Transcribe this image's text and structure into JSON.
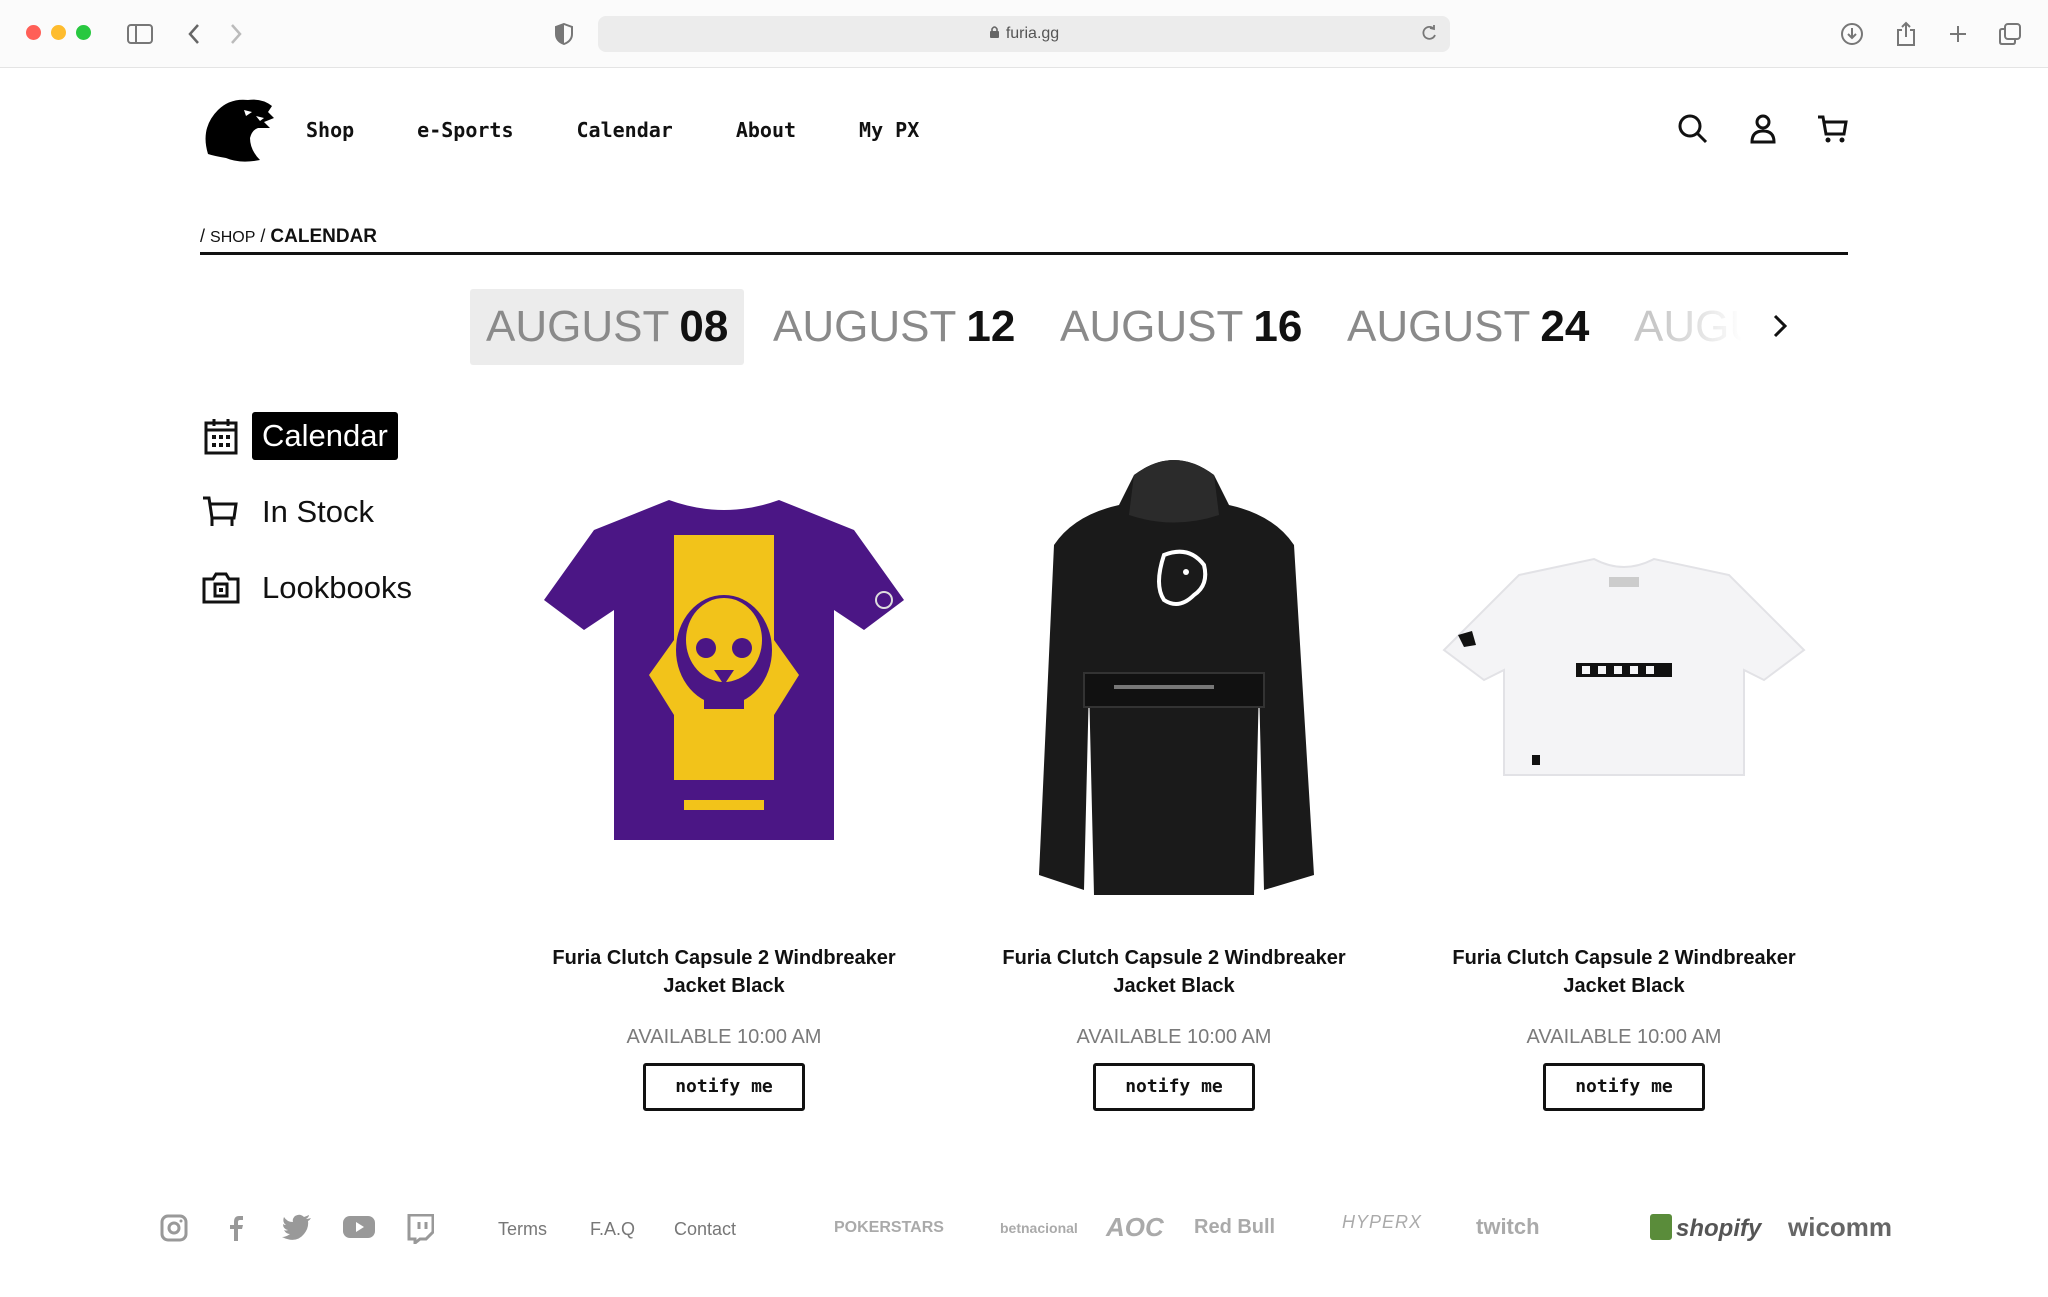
{
  "browser": {
    "url": "furia.gg",
    "icons": [
      "sidebar-icon",
      "back-icon",
      "forward-icon",
      "shield-icon",
      "lock-icon",
      "reload-icon",
      "download-icon",
      "share-icon",
      "new-tab-icon",
      "tabs-overview-icon"
    ]
  },
  "header": {
    "logo": "furia-panther-logo",
    "nav": [
      "Shop",
      "e-Sports",
      "Calendar",
      "About",
      "My PX"
    ],
    "icons": [
      "search-icon",
      "account-icon",
      "cart-icon"
    ]
  },
  "breadcrumb": {
    "sep1": "/",
    "shop": "SHOP",
    "sep2": "/",
    "current": "CALENDAR"
  },
  "dates": [
    {
      "month": "AUGUST",
      "day": "08",
      "active": true
    },
    {
      "month": "AUGUST",
      "day": "12",
      "active": false
    },
    {
      "month": "AUGUST",
      "day": "16",
      "active": false
    },
    {
      "month": "AUGUST",
      "day": "24",
      "active": false
    },
    {
      "month": "AUGU",
      "day": "",
      "active": false
    }
  ],
  "sidebar": [
    {
      "label": "Calendar",
      "icon": "calendar-icon",
      "active": true
    },
    {
      "label": "In Stock",
      "icon": "cart-icon",
      "active": false
    },
    {
      "label": "Lookbooks",
      "icon": "camera-icon",
      "active": false
    }
  ],
  "products": [
    {
      "title_line1": "Furia Clutch Capsule 2 Windbreaker",
      "title_line2": "Jacket Black",
      "availability": "AVAILABLE 10:00 AM",
      "button": "notify me",
      "image": "purple-skull-tshirt"
    },
    {
      "title_line1": "Furia Clutch Capsule 2 Windbreaker",
      "title_line2": "Jacket Black",
      "availability": "AVAILABLE 10:00 AM",
      "button": "notify me",
      "image": "black-windbreaker-jacket"
    },
    {
      "title_line1": "Furia Clutch Capsule 2 Windbreaker",
      "title_line2": "Jacket Black",
      "availability": "AVAILABLE 10:00 AM",
      "button": "notify me",
      "image": "white-crop-tshirt"
    }
  ],
  "footer": {
    "social": [
      "instagram-icon",
      "facebook-icon",
      "twitter-icon",
      "youtube-icon",
      "twitch-icon"
    ],
    "links": [
      "Terms",
      "F.A.Q",
      "Contact"
    ],
    "sponsors": [
      "POKERSTARS",
      "betnacional",
      "AOC",
      "Red Bull",
      "HYPERX",
      "twitch",
      "shopify",
      "wicomm"
    ]
  },
  "colors": {
    "accent": "#000000",
    "muted_text": "#8a8a8a",
    "tab_active_bg": "#ececec",
    "tshirt_purple": "#4b1685",
    "tshirt_print": "#f2c31a"
  }
}
